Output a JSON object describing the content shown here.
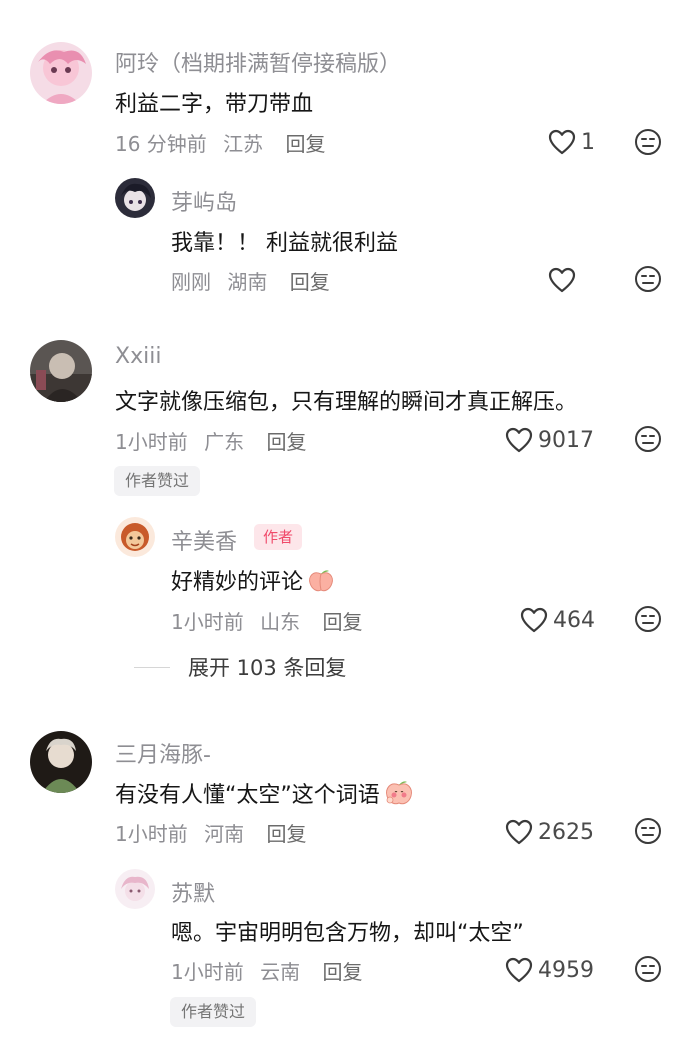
{
  "comments": [
    {
      "name": "阿玲（档期排满暂停接稿版）",
      "text": "利益二字，带刀带血",
      "time": "16 分钟前",
      "location": "江苏",
      "reply": "回复",
      "likes": "1",
      "replies": [
        {
          "name": "芽屿岛",
          "text": "我靠！！ 利益就很利益",
          "time": "刚刚",
          "location": "湖南",
          "reply": "回复",
          "likes": ""
        }
      ]
    },
    {
      "name": "Xxiii",
      "text": "文字就像压缩包，只有理解的瞬间才真正解压。",
      "time": "1小时前",
      "location": "广东",
      "reply": "回复",
      "likes": "9017",
      "badge": "作者赞过",
      "replies": [
        {
          "name": "辛美香",
          "author_tag": "作者",
          "text": "好精妙的评论",
          "emoji": "peach-emoji",
          "time": "1小时前",
          "location": "山东",
          "reply": "回复",
          "likes": "464"
        }
      ],
      "expand_label": "展开 103 条回复"
    },
    {
      "name": "三月海豚-",
      "text": "有没有人懂“太空”这个词语",
      "emoji": "shy-peach-emoji",
      "time": "1小时前",
      "location": "河南",
      "reply": "回复",
      "likes": "2625",
      "replies": [
        {
          "name": "苏默",
          "text": "嗯。宇宙明明包含万物，却叫“太空”",
          "time": "1小时前",
          "location": "云南",
          "reply": "回复",
          "likes": "4959",
          "badge": "作者赞过"
        }
      ]
    }
  ],
  "icons": {
    "like": "heart-outline-icon",
    "dislike": "meh-face-icon"
  },
  "colors": {
    "name": "#8e8e93",
    "text": "#161616",
    "author_tag_bg": "#fde6ea",
    "author_tag_fg": "#f04a6a"
  }
}
